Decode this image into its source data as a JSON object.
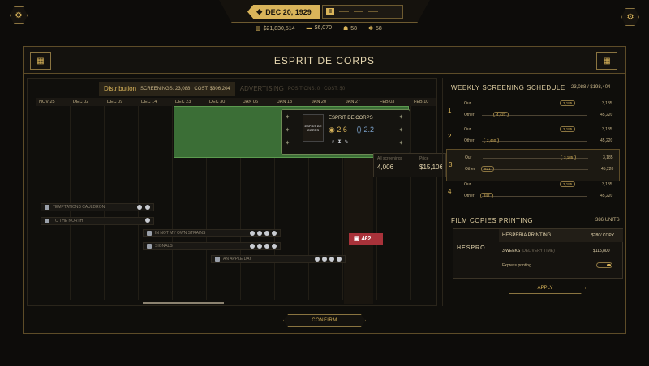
{
  "topbar": {
    "date": "DEC 20, 1929",
    "speed_label": "II"
  },
  "resources": {
    "money": "$21,830,514",
    "income": "$6,070",
    "res3": "58",
    "res4": "58"
  },
  "colors": {
    "accent": "#d9b45a",
    "film_green": "#3b6e36",
    "alert_red": "#a8323a"
  },
  "panel": {
    "title": "ESPRIT DE CORPS"
  },
  "distribution": {
    "tab_label": "Distribution",
    "screenings": "SCREENINGS: 23,088",
    "cost": "COST: $306,204",
    "advertising_label": "ADVERTISING",
    "positions": "POSITIONS: 0",
    "ad_cost": "COST: $0"
  },
  "timeline": [
    "NOV 25",
    "DEC 02",
    "DEC 09",
    "DEC 14",
    "DEC 23",
    "DEC 30",
    "JAN 06",
    "JAN 13",
    "JAN 20",
    "JAN 27",
    "FEB 03",
    "FEB 10"
  ],
  "film_popup": {
    "title": "ESPRIT DE CORPS",
    "poster_text": "ESPRIT DE CORPS",
    "rating1": "2.6",
    "rating2": "2.2"
  },
  "price_box": {
    "all_label": "All screenings",
    "all_value": "4,006",
    "price_label": "Price",
    "price_value": "$15,106"
  },
  "rows": [
    {
      "label": "TEMPTATIONS CAULDRON"
    },
    {
      "label": "TO THE NORTH"
    },
    {
      "label": "IN NOT MY OWN STRAINS"
    },
    {
      "label": "SIGNALS"
    },
    {
      "label": "AN APPLE DAY"
    }
  ],
  "red_tag": {
    "value": "462"
  },
  "schedule": {
    "title": "WEEKLY SCREENING SCHEDULE",
    "summary": "23,088 / $198,404",
    "weeks": [
      {
        "num": "1",
        "our": "Our",
        "other": "Other",
        "our_val": "3,185",
        "other_val": "4,427",
        "our_right": "3,185",
        "other_right": "45,220"
      },
      {
        "num": "2",
        "our": "Our",
        "other": "Other",
        "our_val": "3,185",
        "other_val": "2,460",
        "our_right": "3,185",
        "other_right": "45,220"
      },
      {
        "num": "3",
        "our": "Our",
        "other": "Other",
        "our_val": "3,185",
        "other_val": "821",
        "our_right": "3,185",
        "other_right": "45,220"
      },
      {
        "num": "4",
        "our": "Our",
        "other": "Other",
        "our_val": "3,185",
        "other_val": "342",
        "our_right": "3,185",
        "other_right": "45,220"
      }
    ]
  },
  "printing": {
    "title": "FILM COPIES PRINTING",
    "units": "386 UNITS",
    "logo_text": "HESPRO",
    "company": "HESPERIA PRINTING",
    "per_copy": "$280/ COPY",
    "weeks": "3 WEEKS",
    "weeks_note": "(DELIVERY TIME)",
    "total": "$115,800",
    "express_label": "Express printing",
    "apply_label": "APPLY"
  },
  "confirm_label": "CONFIRM"
}
